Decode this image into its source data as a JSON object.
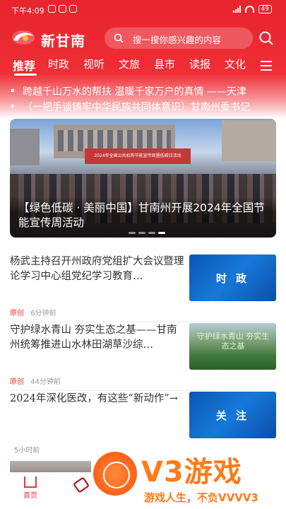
{
  "status_bar": {
    "time": "下午4:09",
    "battery": "49"
  },
  "app": {
    "name": "新甘南"
  },
  "search": {
    "placeholder": "搜一搜你感兴趣的内容"
  },
  "tabs": [
    "推荐",
    "时政",
    "视听",
    "文旅",
    "县市",
    "读报",
    "文化"
  ],
  "active_tab": "推荐",
  "headlines": [
    "跨越千山万水的帮扶  温暖千家万户的真情  ——天津",
    "（一把手谈铸牢中华民族共同体意识）甘南州委书记"
  ],
  "banner": {
    "title": "【绿色低碳 · 美丽中国】甘南州开展2024年全国节能宣传周活动",
    "slide_count": 4,
    "active_slide": 3,
    "photo_banner_text": "2024年全国公共机构节能宣传周暨低碳日活动"
  },
  "news": [
    {
      "title": "杨武主持召开州政府党组扩大会议暨理论学习中心组党纪学习教育…",
      "tag": "原创",
      "time": "6分钟前",
      "thumb_text": "时 政"
    },
    {
      "title": "守护绿水青山  夯实生态之基——甘南州统筹推进山水林田湖草沙综…",
      "tag": "原创",
      "time": "44分钟前",
      "thumb_text": "守护绿水青山 夯实生态之基"
    },
    {
      "title": "2024年深化医改，有这些“新动作”→",
      "tag": "",
      "time": "5小时前",
      "thumb_text": "关  注"
    }
  ],
  "tabbar": {
    "home_label": "首页"
  },
  "watermark": {
    "brand": "V3游戏",
    "slogan": "游戏人生，不负VVVV3"
  },
  "colors": {
    "brand_red": "#e8242d",
    "news_tag": "#ee3333",
    "thumb_blue": "#1778d8",
    "watermark_orange": "#ff7a1a"
  }
}
